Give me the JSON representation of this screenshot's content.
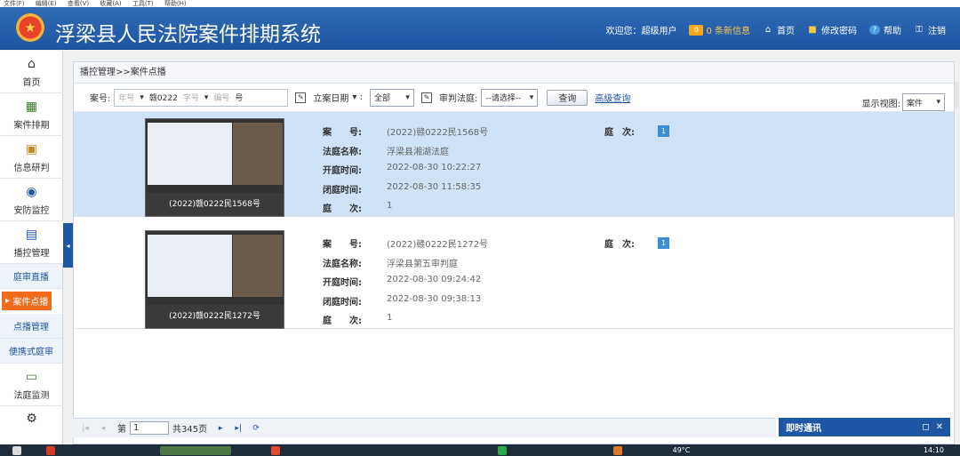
{
  "menubar": [
    "文件(F)",
    "编辑(E)",
    "查看(V)",
    "收藏(A)",
    "工具(T)",
    "帮助(H)"
  ],
  "header": {
    "title": "浮梁县人民法院案件排期系统",
    "welcome": "欢迎您：超级用户",
    "msg_count": "0",
    "msg_label": "0 条新信息",
    "home": "首页",
    "change_pwd": "修改密码",
    "help": "帮助",
    "logout": "注销",
    "accent": "#1e56a3"
  },
  "sidebar": {
    "items": [
      {
        "label": "首页",
        "icon": "home-icon"
      },
      {
        "label": "案件排期",
        "icon": "calendar-icon"
      },
      {
        "label": "信息研判",
        "icon": "analysis-icon"
      },
      {
        "label": "安防监控",
        "icon": "camera-icon"
      },
      {
        "label": "播控管理",
        "icon": "monitor-icon"
      }
    ],
    "subitems": [
      "庭审直播",
      "案件点播",
      "点播管理",
      "便携式庭审"
    ],
    "current_sub": "案件点播",
    "bottom": [
      {
        "label": "法庭监测",
        "icon": "monitor-icon"
      }
    ]
  },
  "breadcrumb": "播控管理>>案件点播",
  "filter": {
    "case_label": "案号:",
    "year_ph": "年号",
    "court_code": "赣0222",
    "type_ph": "字号",
    "num_ph": "编号",
    "hao": "号",
    "date_label": "立案日期",
    "date_value": "全部",
    "court_label": "审判法庭:",
    "court_value": "--请选择--",
    "query": "查询",
    "advanced": "高级查询",
    "view_label": "显示视图:",
    "view_value": "案件"
  },
  "rows": [
    {
      "caption": "(2022)赣0222民1568号",
      "case_no_label": "案　　号:",
      "case_no": "(2022)赣0222民1568号",
      "court_label": "法庭名称:",
      "court": "浮梁县湘湖法庭",
      "open_label": "开庭时间:",
      "open": "2022-08-30 10:22:27",
      "close_label": "闭庭时间:",
      "close": "2022-08-30 11:58:35",
      "session_label": "庭　　次:",
      "session": "1",
      "ting_label": "庭　次:",
      "ting_badge": "1"
    },
    {
      "caption": "(2022)赣0222民1272号",
      "case_no_label": "案　　号:",
      "case_no": "(2022)赣0222民1272号",
      "court_label": "法庭名称:",
      "court": "浮梁县第五审判庭",
      "open_label": "开庭时间:",
      "open": "2022-08-30 09:24:42",
      "close_label": "闭庭时间:",
      "close": "2022-08-30 09:38:13",
      "session_label": "庭　　次:",
      "session": "1",
      "ting_label": "庭　次:",
      "ting_badge": "1"
    }
  ],
  "pager": {
    "page_label": "第",
    "page_value": "1",
    "total": "共345页"
  },
  "chat": {
    "label": "即时通讯"
  },
  "taskbar": {
    "temp": "49°C",
    "time": "14:10"
  }
}
